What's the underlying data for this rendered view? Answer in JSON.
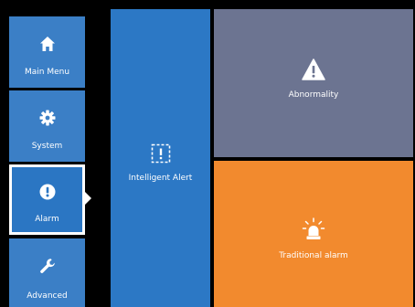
{
  "sidebar": {
    "items": [
      {
        "label": "Main Menu",
        "icon": "home-icon"
      },
      {
        "label": "System",
        "icon": "gear-icon"
      },
      {
        "label": "Alarm",
        "icon": "alert-circle-icon",
        "selected": true
      },
      {
        "label": "Advanced",
        "icon": "wrench-icon"
      }
    ]
  },
  "tiles": {
    "intelligent_alert": {
      "label": "Intelligent Alert",
      "icon": "intelligent-alert-icon",
      "color": "#2c78c5"
    },
    "abnormality": {
      "label": "Abnormality",
      "icon": "warning-triangle-icon",
      "color": "#6c7491"
    },
    "traditional_alarm": {
      "label": "Traditional alarm",
      "icon": "siren-icon",
      "color": "#f28a2e"
    }
  },
  "colors": {
    "background": "#000000",
    "sidebar": "#3b7fc6",
    "selected_border": "#ffffff"
  }
}
